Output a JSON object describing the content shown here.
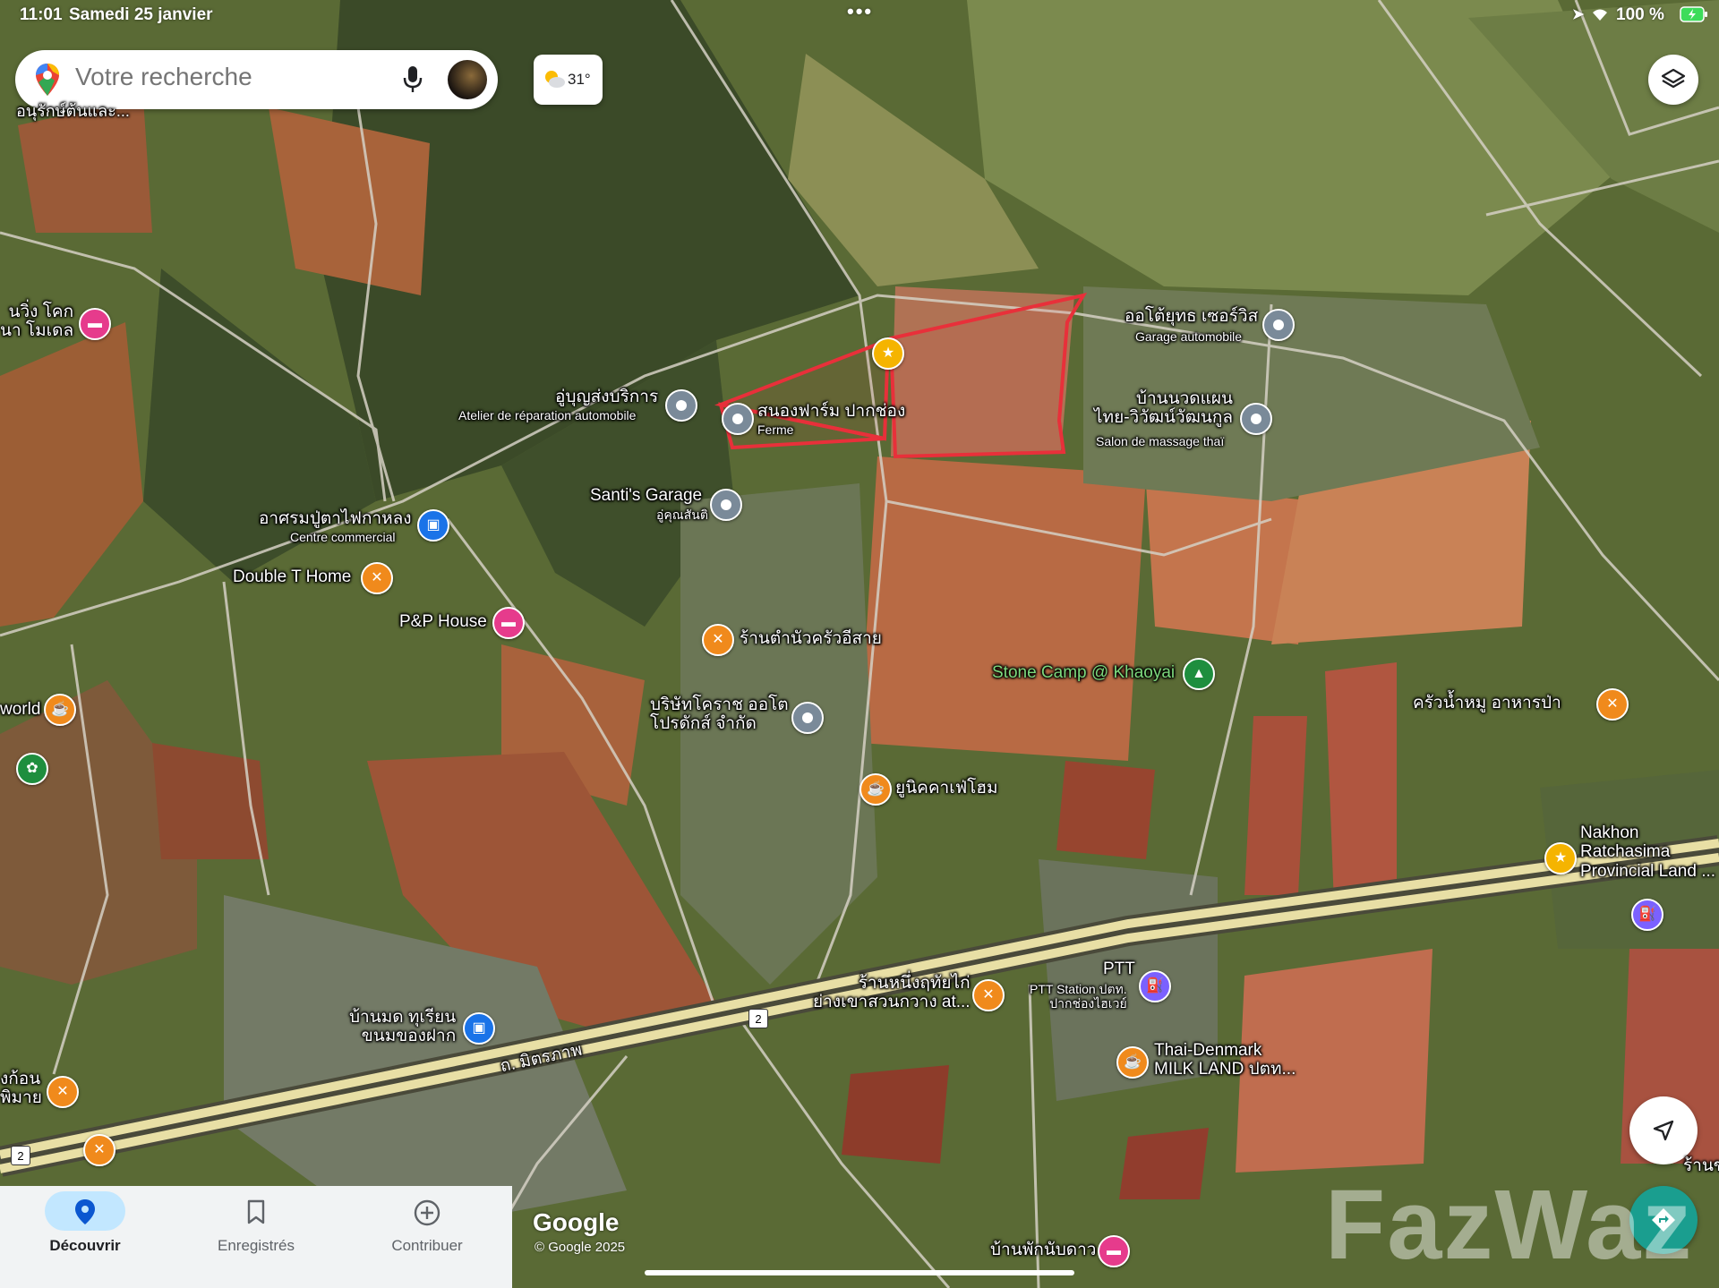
{
  "status_bar": {
    "time": "11:01",
    "date": "Samedi 25 janvier",
    "battery": "100 %"
  },
  "search": {
    "placeholder": "Votre recherche"
  },
  "weather": {
    "temp": "31°"
  },
  "bottom_nav": [
    {
      "label": "Découvrir",
      "icon": "location-pin-icon",
      "active": true
    },
    {
      "label": "Enregistrés",
      "icon": "bookmark-icon",
      "active": false
    },
    {
      "label": "Contribuer",
      "icon": "add-circle-icon",
      "active": false
    }
  ],
  "places": [
    {
      "id": "p1",
      "name": "อู่บุญส่งบริการ",
      "sub": "Atelier de réparation automobile",
      "type": "gray"
    },
    {
      "id": "p2",
      "name": "สนองฟาร์ม ปากช่อง",
      "sub": "Ferme",
      "type": "gray"
    },
    {
      "id": "p3",
      "name": "ออโต้ยุทธ เซอร์วิส",
      "sub": "Garage automobile",
      "type": "gray"
    },
    {
      "id": "p4",
      "name": "บ้านนวดแผน\nไทย-วิวัฒน์วัฒนกูล",
      "sub": "Salon de massage thaï",
      "type": "gray"
    },
    {
      "id": "p5",
      "name": "Santi's Garage",
      "sub": "อู่คุณสันติ",
      "type": "gray"
    },
    {
      "id": "p6",
      "name": "อาศรมปู่ตาไฟกาหลง",
      "sub": "Centre commercial",
      "type": "blue"
    },
    {
      "id": "p7",
      "name": "Double T Home",
      "sub": "",
      "type": "orange"
    },
    {
      "id": "p8",
      "name": "P&P House",
      "sub": "",
      "type": "pink"
    },
    {
      "id": "p9",
      "name": "ร้านตำนัวครัวอีสาย",
      "sub": "",
      "type": "orange"
    },
    {
      "id": "p10",
      "name": "บริษัทโคราช ออโต\nโปรดักส์ จำกัด",
      "sub": "",
      "type": "gray"
    },
    {
      "id": "p11",
      "name": "Stone Camp @ Khaoyai",
      "sub": "",
      "type": "green"
    },
    {
      "id": "p12",
      "name": "ครัวน้ำหมู อาหารป่า",
      "sub": "",
      "type": "orange"
    },
    {
      "id": "p13",
      "name": "ยูนิคคาเฟ่โฮม",
      "sub": "",
      "type": "orange"
    },
    {
      "id": "p14",
      "name": "Nakhon\nRatchasima\nProvincial Land ...",
      "sub": "",
      "type": "yellow"
    },
    {
      "id": "p15",
      "name": "ร้านหนึ่งฤทัยไก่\nย่างเขาสวนกวาง at...",
      "sub": "",
      "type": "orange"
    },
    {
      "id": "p16",
      "name": "PTT",
      "sub": "PTT Station ปตท.\nปากช่องไฮเวย์",
      "type": "purple"
    },
    {
      "id": "p17",
      "name": "Thai-Denmark\nMILK LAND ปตท...",
      "sub": "",
      "type": "orange"
    },
    {
      "id": "p18",
      "name": "บ้านมด ทุเรียน\nขนมของฝาก",
      "sub": "",
      "type": "blue"
    },
    {
      "id": "p19",
      "name": "บ้านพักนับดาว",
      "sub": "",
      "type": "pink"
    },
    {
      "id": "p20",
      "name": "นวิ่ง โคก\nนา โมเดล",
      "sub": "",
      "type": "pink"
    },
    {
      "id": "p21",
      "name": "world",
      "sub": "",
      "type": "orange"
    },
    {
      "id": "p22",
      "name": "งก้อน\nพิมาย",
      "sub": "",
      "type": "orange"
    },
    {
      "id": "p23",
      "name": "อนุรักษ์ต้นและ...",
      "sub": "",
      "type": "none"
    },
    {
      "id": "p24",
      "name": "ร้านข",
      "sub": "",
      "type": "none"
    }
  ],
  "road": {
    "name": "ถ. มิตรภาพ",
    "shield": "2"
  },
  "attribution": {
    "logo": "Google",
    "copyright": "© Google 2025"
  },
  "watermark": "FazWaz",
  "colors": {
    "accent": "#1a73e8",
    "highlight": "#e8303a",
    "road": "#e8dfa5"
  }
}
